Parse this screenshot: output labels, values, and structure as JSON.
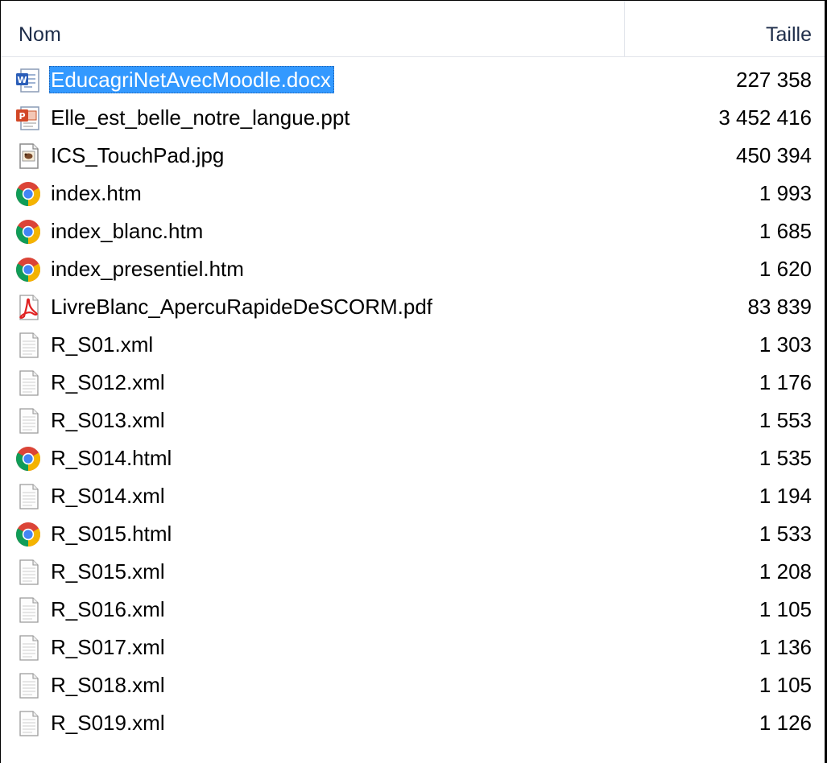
{
  "columns": {
    "name": "Nom",
    "size": "Taille"
  },
  "files": [
    {
      "name": "EducagriNetAvecMoodle.docx",
      "size": "227 358",
      "icon": "word-document-icon",
      "selected": true
    },
    {
      "name": "Elle_est_belle_notre_langue.ppt",
      "size": "3 452 416",
      "icon": "powerpoint-icon",
      "selected": false
    },
    {
      "name": "ICS_TouchPad.jpg",
      "size": "450 394",
      "icon": "image-file-icon",
      "selected": false
    },
    {
      "name": "index.htm",
      "size": "1 993",
      "icon": "chrome-icon",
      "selected": false
    },
    {
      "name": "index_blanc.htm",
      "size": "1 685",
      "icon": "chrome-icon",
      "selected": false
    },
    {
      "name": "index_presentiel.htm",
      "size": "1 620",
      "icon": "chrome-icon",
      "selected": false
    },
    {
      "name": "LivreBlanc_ApercuRapideDeSCORM.pdf",
      "size": "83 839",
      "icon": "pdf-icon",
      "selected": false
    },
    {
      "name": "R_S01.xml",
      "size": "1 303",
      "icon": "text-file-icon",
      "selected": false
    },
    {
      "name": "R_S012.xml",
      "size": "1 176",
      "icon": "text-file-icon",
      "selected": false
    },
    {
      "name": "R_S013.xml",
      "size": "1 553",
      "icon": "text-file-icon",
      "selected": false
    },
    {
      "name": "R_S014.html",
      "size": "1 535",
      "icon": "chrome-icon",
      "selected": false
    },
    {
      "name": "R_S014.xml",
      "size": "1 194",
      "icon": "text-file-icon",
      "selected": false
    },
    {
      "name": "R_S015.html",
      "size": "1 533",
      "icon": "chrome-icon",
      "selected": false
    },
    {
      "name": "R_S015.xml",
      "size": "1 208",
      "icon": "text-file-icon",
      "selected": false
    },
    {
      "name": "R_S016.xml",
      "size": "1 105",
      "icon": "text-file-icon",
      "selected": false
    },
    {
      "name": "R_S017.xml",
      "size": "1 136",
      "icon": "text-file-icon",
      "selected": false
    },
    {
      "name": "R_S018.xml",
      "size": "1 105",
      "icon": "text-file-icon",
      "selected": false
    },
    {
      "name": "R_S019.xml",
      "size": "1 126",
      "icon": "text-file-icon",
      "selected": false
    }
  ],
  "colors": {
    "selection": "#3399ff",
    "header_text": "#1e2d4a"
  }
}
